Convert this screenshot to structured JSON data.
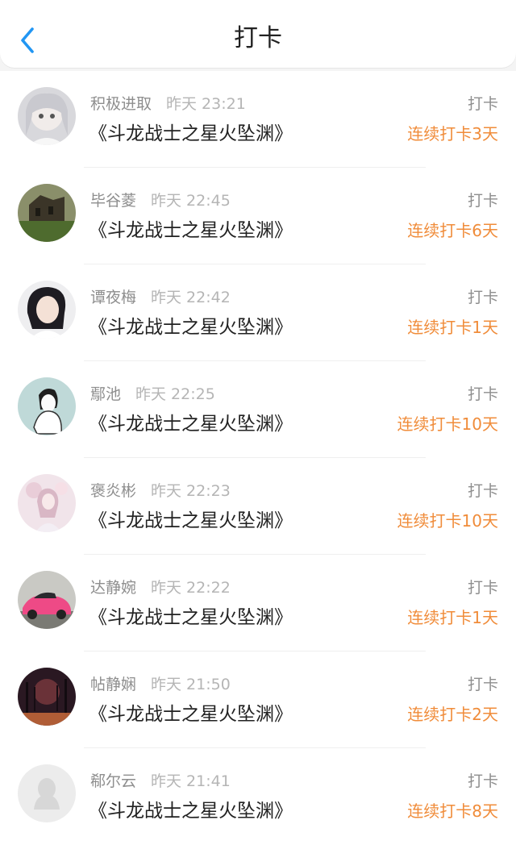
{
  "header": {
    "title": "打卡"
  },
  "items": [
    {
      "name": "积极进取",
      "time": "昨天 23:21",
      "book": "《斗龙战士之星火坠渊》",
      "action": "打卡",
      "streak": "连续打卡3天"
    },
    {
      "name": "毕谷菱",
      "time": "昨天 22:45",
      "book": "《斗龙战士之星火坠渊》",
      "action": "打卡",
      "streak": "连续打卡6天"
    },
    {
      "name": "谭夜梅",
      "time": "昨天 22:42",
      "book": "《斗龙战士之星火坠渊》",
      "action": "打卡",
      "streak": "连续打卡1天"
    },
    {
      "name": "鄢池",
      "time": "昨天 22:25",
      "book": "《斗龙战士之星火坠渊》",
      "action": "打卡",
      "streak": "连续打卡10天"
    },
    {
      "name": "褒炎彬",
      "time": "昨天 22:23",
      "book": "《斗龙战士之星火坠渊》",
      "action": "打卡",
      "streak": "连续打卡10天"
    },
    {
      "name": "达静婉",
      "time": "昨天 22:22",
      "book": "《斗龙战士之星火坠渊》",
      "action": "打卡",
      "streak": "连续打卡1天"
    },
    {
      "name": "帖静娴",
      "time": "昨天 21:50",
      "book": "《斗龙战士之星火坠渊》",
      "action": "打卡",
      "streak": "连续打卡2天"
    },
    {
      "name": "郗尔云",
      "time": "昨天 21:41",
      "book": "《斗龙战士之星火坠渊》",
      "action": "打卡",
      "streak": "连续打卡8天"
    }
  ],
  "colors": {
    "accent_back": "#2196f3",
    "streak": "#f08c3a"
  }
}
